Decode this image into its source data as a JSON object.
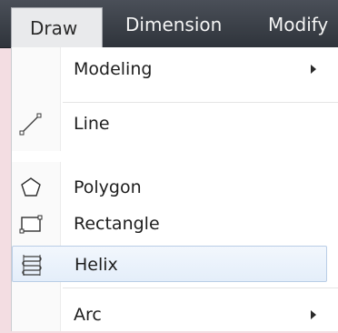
{
  "menubar": {
    "items": [
      {
        "label": "Draw"
      },
      {
        "label": "Dimension"
      },
      {
        "label": "Modify"
      }
    ]
  },
  "draw_menu": {
    "items": [
      {
        "label": "Modeling",
        "has_submenu": true
      },
      {
        "label": "Line",
        "icon": "line-icon"
      },
      {
        "label": "Polygon",
        "icon": "polygon-icon"
      },
      {
        "label": "Rectangle",
        "icon": "rectangle-icon"
      },
      {
        "label": "Helix",
        "icon": "helix-icon",
        "highlighted": true
      },
      {
        "label": "Arc",
        "has_submenu": true
      }
    ]
  },
  "colors": {
    "menubar_bg": "#3a3f47",
    "highlight_border": "#b9cde6",
    "highlight_bg": "#e8f0fa"
  }
}
